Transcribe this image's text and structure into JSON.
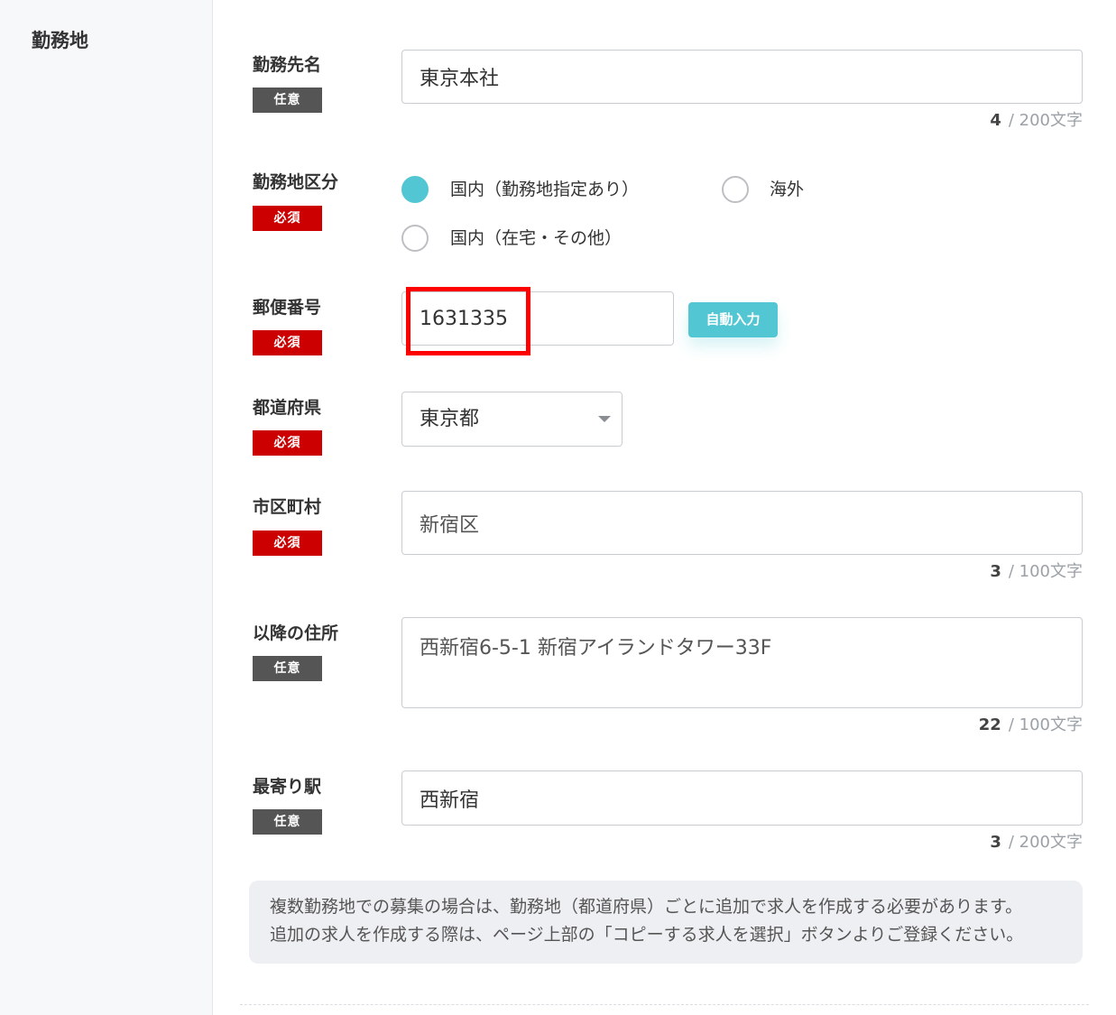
{
  "section": {
    "title": "勤務地"
  },
  "fields": {
    "workplace_name": {
      "label": "勤務先名",
      "badge": "任意",
      "value": "東京本社",
      "count": "4",
      "limit": "/ 200文字"
    },
    "location_type": {
      "label": "勤務地区分",
      "badge": "必須",
      "options": [
        {
          "label": "国内（勤務地指定あり）",
          "selected": true
        },
        {
          "label": "海外",
          "selected": false
        },
        {
          "label": "国内（在宅・その他）",
          "selected": false
        }
      ]
    },
    "postal_code": {
      "label": "郵便番号",
      "badge": "必須",
      "value": "1631335",
      "auto_fill_button": "自動入力"
    },
    "prefecture": {
      "label": "都道府県",
      "badge": "必須",
      "value": "東京都"
    },
    "city": {
      "label": "市区町村",
      "badge": "必須",
      "value": "新宿区",
      "count": "3",
      "limit": "/ 100文字"
    },
    "address": {
      "label": "以降の住所",
      "badge": "任意",
      "value": "西新宿6-5-1 新宿アイランドタワー33F",
      "count": "22",
      "limit": "/ 100文字"
    },
    "station": {
      "label": "最寄り駅",
      "badge": "任意",
      "value": "西新宿",
      "count": "3",
      "limit": "/ 200文字"
    }
  },
  "note": {
    "lines": [
      "複数勤務地での募集の場合は、勤務地（都道府県）ごとに追加で求人を作成する必要があります。",
      "追加の求人を作成する際は、ページ上部の「コピーする求人を選択」ボタンよりご登録ください。"
    ]
  },
  "icons": {
    "select_caret": "caret-down-icon"
  },
  "colors": {
    "accent": "#52c7d3",
    "required": "#cc0000",
    "optional": "#555555",
    "highlight": "#ff0000"
  }
}
